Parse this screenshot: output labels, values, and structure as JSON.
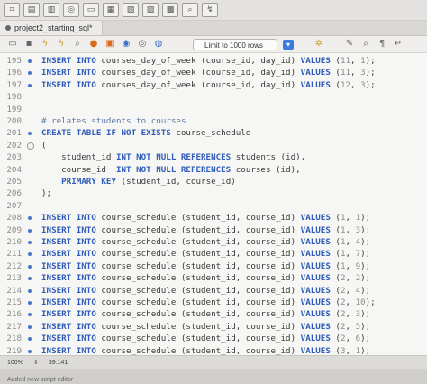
{
  "tab": {
    "label": "project2_starting_sql*"
  },
  "toolbar": {
    "limit_label": "Limit to 1000 rows"
  },
  "editor": {
    "lines": [
      {
        "n": "195",
        "m": "dot",
        "tokens": [
          [
            "kw",
            "INSERT INTO"
          ],
          [
            "t",
            " courses_day_of_week (course_id, day_id) "
          ],
          [
            "kw",
            "VALUES"
          ],
          [
            "t",
            " ("
          ],
          [
            "num",
            "11"
          ],
          [
            "t",
            ", "
          ],
          [
            "num",
            "1"
          ],
          [
            "t",
            ");"
          ]
        ]
      },
      {
        "n": "196",
        "m": "dot",
        "tokens": [
          [
            "kw",
            "INSERT INTO"
          ],
          [
            "t",
            " courses_day_of_week (course_id, day_id) "
          ],
          [
            "kw",
            "VALUES"
          ],
          [
            "t",
            " ("
          ],
          [
            "num",
            "11"
          ],
          [
            "t",
            ", "
          ],
          [
            "num",
            "3"
          ],
          [
            "t",
            ");"
          ]
        ]
      },
      {
        "n": "197",
        "m": "dot",
        "tokens": [
          [
            "kw",
            "INSERT INTO"
          ],
          [
            "t",
            " courses_day_of_week (course_id, day_id) "
          ],
          [
            "kw",
            "VALUES"
          ],
          [
            "t",
            " ("
          ],
          [
            "num",
            "12"
          ],
          [
            "t",
            ", "
          ],
          [
            "num",
            "3"
          ],
          [
            "t",
            ");"
          ]
        ]
      },
      {
        "n": "198",
        "m": "",
        "tokens": []
      },
      {
        "n": "199",
        "m": "",
        "tokens": []
      },
      {
        "n": "200",
        "m": "",
        "tokens": [
          [
            "cm",
            "# relates students to courses"
          ]
        ]
      },
      {
        "n": "201",
        "m": "dot",
        "tokens": [
          [
            "kw",
            "CREATE TABLE IF NOT EXISTS"
          ],
          [
            "t",
            " course_schedule"
          ]
        ]
      },
      {
        "n": "202",
        "m": "fold",
        "tokens": [
          [
            "t",
            "("
          ]
        ]
      },
      {
        "n": "203",
        "m": "",
        "tokens": [
          [
            "t",
            "    student_id "
          ],
          [
            "kw",
            "INT NOT NULL REFERENCES"
          ],
          [
            "t",
            " students (id),"
          ]
        ]
      },
      {
        "n": "204",
        "m": "",
        "tokens": [
          [
            "t",
            "    course_id  "
          ],
          [
            "kw",
            "INT NOT NULL REFERENCES"
          ],
          [
            "t",
            " courses (id),"
          ]
        ]
      },
      {
        "n": "205",
        "m": "",
        "tokens": [
          [
            "t",
            "    "
          ],
          [
            "kw",
            "PRIMARY KEY"
          ],
          [
            "t",
            " (student_id, course_id)"
          ]
        ]
      },
      {
        "n": "206",
        "m": "",
        "tokens": [
          [
            "t",
            ");"
          ]
        ]
      },
      {
        "n": "207",
        "m": "",
        "tokens": []
      },
      {
        "n": "208",
        "m": "dot",
        "tokens": [
          [
            "kw",
            "INSERT INTO"
          ],
          [
            "t",
            " course_schedule (student_id, course_id) "
          ],
          [
            "kw",
            "VALUES"
          ],
          [
            "t",
            " ("
          ],
          [
            "num",
            "1"
          ],
          [
            "t",
            ", "
          ],
          [
            "num",
            "1"
          ],
          [
            "t",
            ");"
          ]
        ]
      },
      {
        "n": "209",
        "m": "dot",
        "tokens": [
          [
            "kw",
            "INSERT INTO"
          ],
          [
            "t",
            " course_schedule (student_id, course_id) "
          ],
          [
            "kw",
            "VALUES"
          ],
          [
            "t",
            " ("
          ],
          [
            "num",
            "1"
          ],
          [
            "t",
            ", "
          ],
          [
            "num",
            "3"
          ],
          [
            "t",
            ");"
          ]
        ]
      },
      {
        "n": "210",
        "m": "dot",
        "tokens": [
          [
            "kw",
            "INSERT INTO"
          ],
          [
            "t",
            " course_schedule (student_id, course_id) "
          ],
          [
            "kw",
            "VALUES"
          ],
          [
            "t",
            " ("
          ],
          [
            "num",
            "1"
          ],
          [
            "t",
            ", "
          ],
          [
            "num",
            "4"
          ],
          [
            "t",
            ");"
          ]
        ]
      },
      {
        "n": "211",
        "m": "dot",
        "tokens": [
          [
            "kw",
            "INSERT INTO"
          ],
          [
            "t",
            " course_schedule (student_id, course_id) "
          ],
          [
            "kw",
            "VALUES"
          ],
          [
            "t",
            " ("
          ],
          [
            "num",
            "1"
          ],
          [
            "t",
            ", "
          ],
          [
            "num",
            "7"
          ],
          [
            "t",
            ");"
          ]
        ]
      },
      {
        "n": "212",
        "m": "dot",
        "tokens": [
          [
            "kw",
            "INSERT INTO"
          ],
          [
            "t",
            " course_schedule (student_id, course_id) "
          ],
          [
            "kw",
            "VALUES"
          ],
          [
            "t",
            " ("
          ],
          [
            "num",
            "1"
          ],
          [
            "t",
            ", "
          ],
          [
            "num",
            "9"
          ],
          [
            "t",
            ");"
          ]
        ]
      },
      {
        "n": "213",
        "m": "dot",
        "tokens": [
          [
            "kw",
            "INSERT INTO"
          ],
          [
            "t",
            " course_schedule (student_id, course_id) "
          ],
          [
            "kw",
            "VALUES"
          ],
          [
            "t",
            " ("
          ],
          [
            "num",
            "2"
          ],
          [
            "t",
            ", "
          ],
          [
            "num",
            "2"
          ],
          [
            "t",
            ");"
          ]
        ]
      },
      {
        "n": "214",
        "m": "dot",
        "tokens": [
          [
            "kw",
            "INSERT INTO"
          ],
          [
            "t",
            " course_schedule (student_id, course_id) "
          ],
          [
            "kw",
            "VALUES"
          ],
          [
            "t",
            " ("
          ],
          [
            "num",
            "2"
          ],
          [
            "t",
            ", "
          ],
          [
            "num",
            "4"
          ],
          [
            "t",
            ");"
          ]
        ]
      },
      {
        "n": "215",
        "m": "dot",
        "tokens": [
          [
            "kw",
            "INSERT INTO"
          ],
          [
            "t",
            " course_schedule (student_id, course_id) "
          ],
          [
            "kw",
            "VALUES"
          ],
          [
            "t",
            " ("
          ],
          [
            "num",
            "2"
          ],
          [
            "t",
            ", "
          ],
          [
            "num",
            "10"
          ],
          [
            "t",
            ");"
          ]
        ]
      },
      {
        "n": "216",
        "m": "dot",
        "tokens": [
          [
            "kw",
            "INSERT INTO"
          ],
          [
            "t",
            " course_schedule (student_id, course_id) "
          ],
          [
            "kw",
            "VALUES"
          ],
          [
            "t",
            " ("
          ],
          [
            "num",
            "2"
          ],
          [
            "t",
            ", "
          ],
          [
            "num",
            "3"
          ],
          [
            "t",
            ");"
          ]
        ]
      },
      {
        "n": "217",
        "m": "dot",
        "tokens": [
          [
            "kw",
            "INSERT INTO"
          ],
          [
            "t",
            " course_schedule (student_id, course_id) "
          ],
          [
            "kw",
            "VALUES"
          ],
          [
            "t",
            " ("
          ],
          [
            "num",
            "2"
          ],
          [
            "t",
            ", "
          ],
          [
            "num",
            "5"
          ],
          [
            "t",
            ");"
          ]
        ]
      },
      {
        "n": "218",
        "m": "dot",
        "tokens": [
          [
            "kw",
            "INSERT INTO"
          ],
          [
            "t",
            " course_schedule (student_id, course_id) "
          ],
          [
            "kw",
            "VALUES"
          ],
          [
            "t",
            " ("
          ],
          [
            "num",
            "2"
          ],
          [
            "t",
            ", "
          ],
          [
            "num",
            "6"
          ],
          [
            "t",
            ");"
          ]
        ]
      },
      {
        "n": "219",
        "m": "dot",
        "tokens": [
          [
            "kw",
            "INSERT INTO"
          ],
          [
            "t",
            " course_schedule (student_id, course_id) "
          ],
          [
            "kw",
            "VALUES"
          ],
          [
            "t",
            " ("
          ],
          [
            "num",
            "3"
          ],
          [
            "t",
            ", "
          ],
          [
            "num",
            "1"
          ],
          [
            "t",
            ");"
          ]
        ]
      }
    ]
  },
  "status": {
    "zoom": "100%",
    "cursor": "39:141"
  },
  "output": {
    "text": "Added new script editor"
  },
  "colors": {
    "keyword": "#2f5cb8",
    "number": "#8a8a8a",
    "comment": "#5e79a8",
    "marker": "#4a78c8"
  }
}
